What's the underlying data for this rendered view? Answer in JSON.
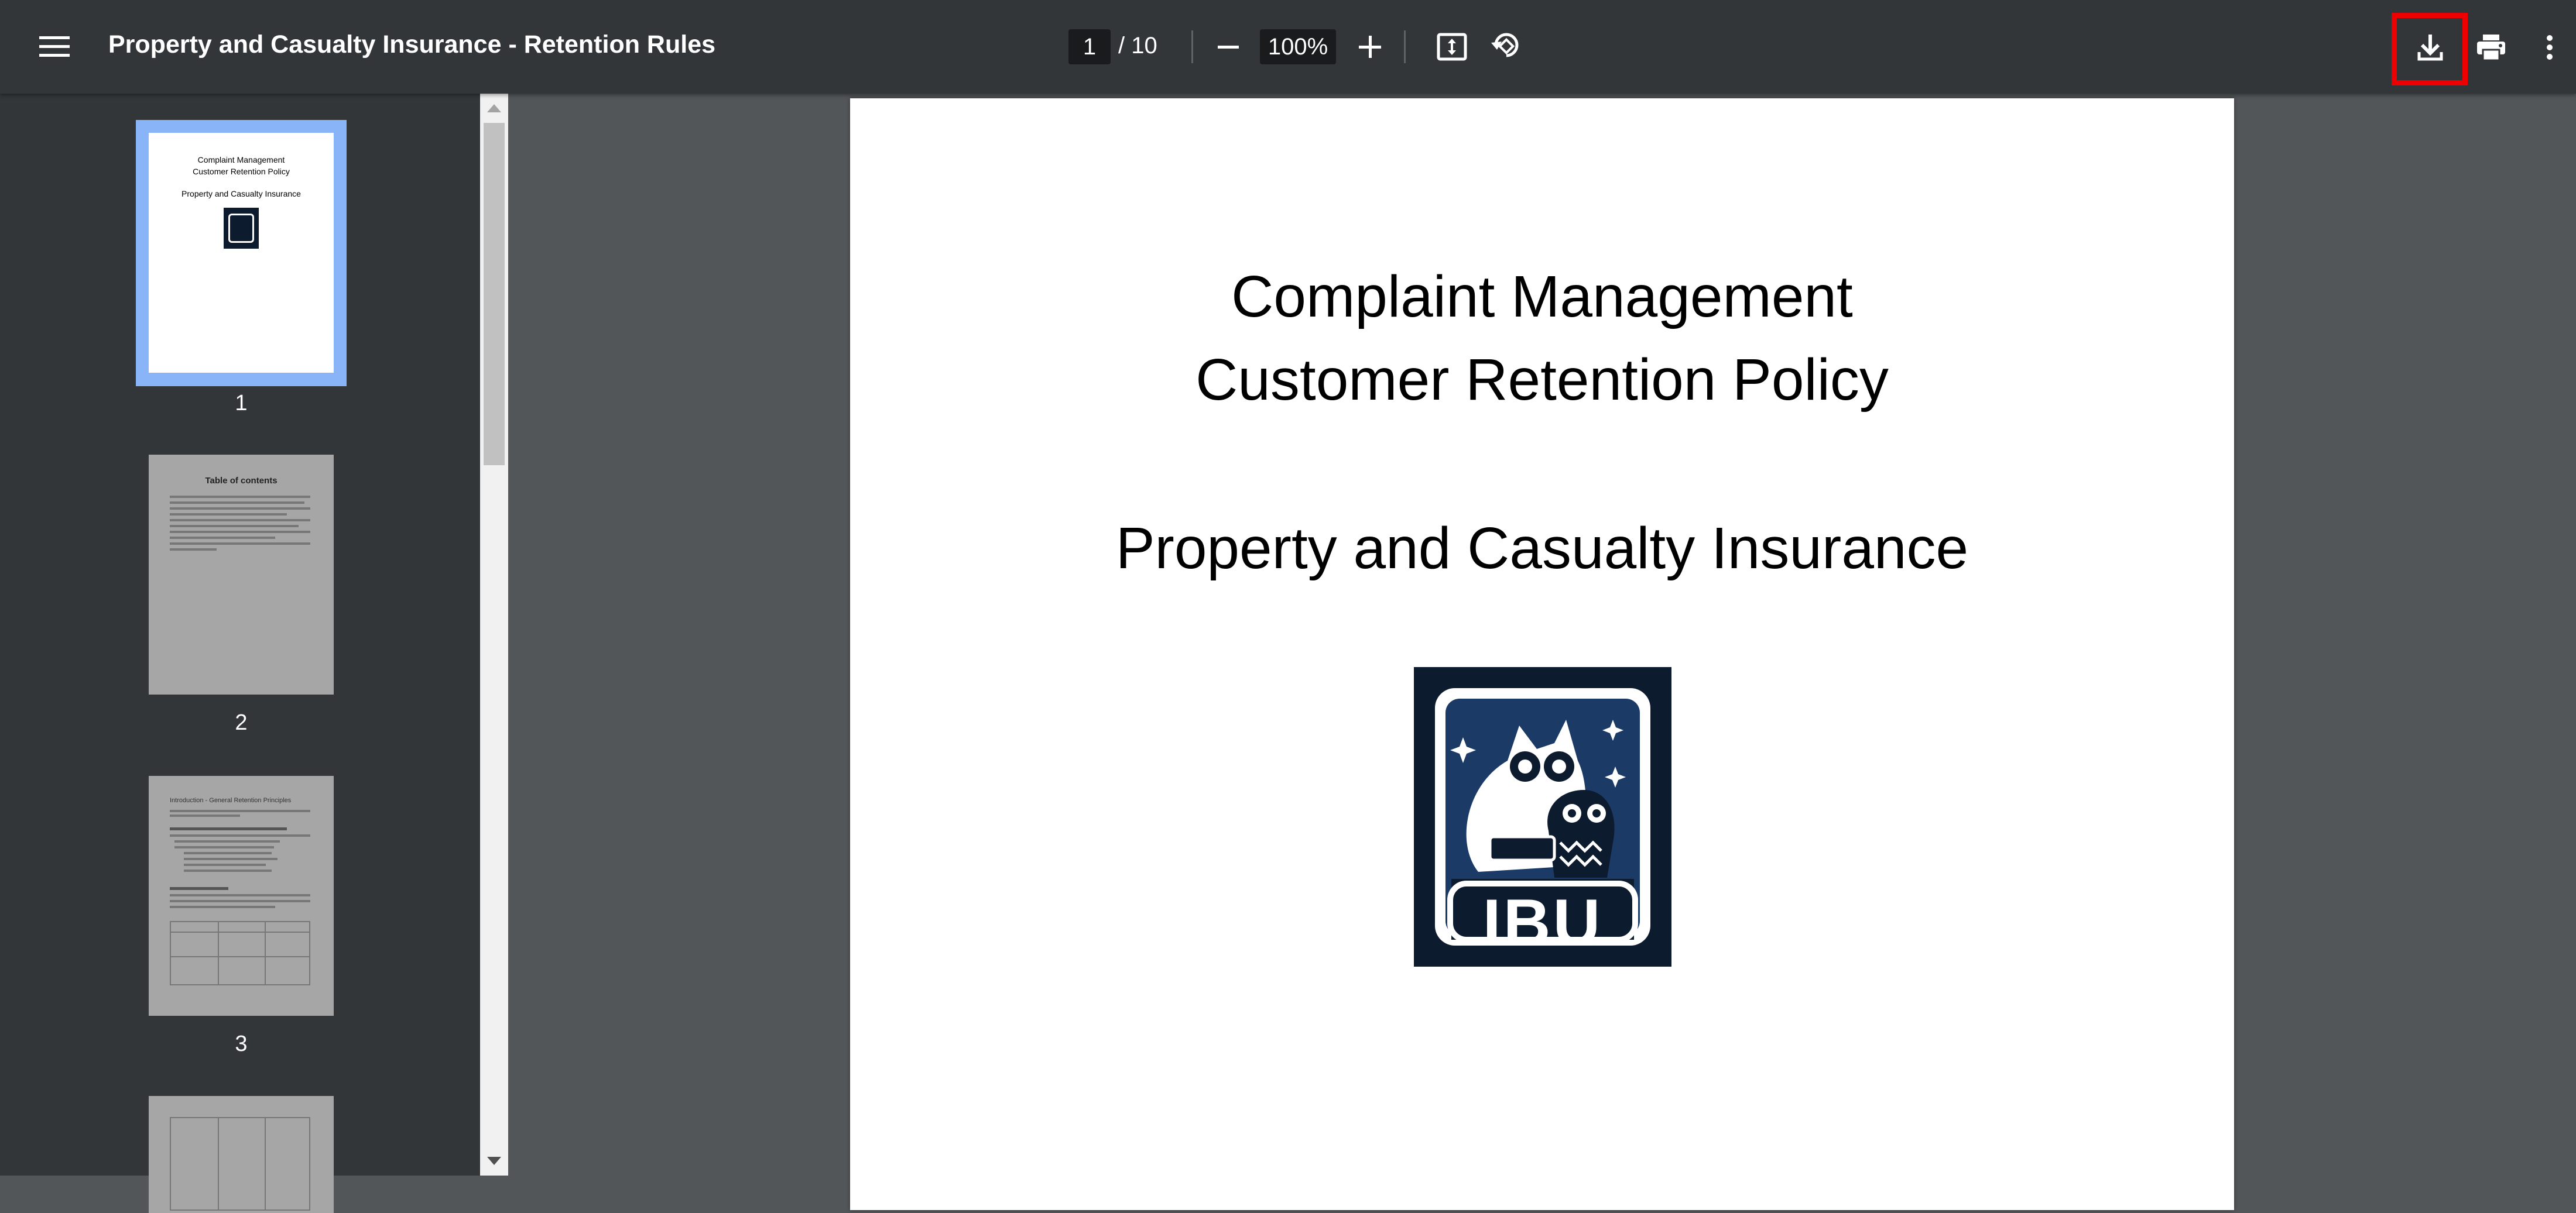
{
  "toolbar": {
    "menu_icon": "hamburger-menu-icon",
    "title": "Property and Casualty Insurance - Retention Rules",
    "current_page": "1",
    "page_total": "/ 10",
    "zoom": "100%",
    "zoom_out_icon": "minus-icon",
    "zoom_in_icon": "plus-icon",
    "fit_icon": "fit-to-page-icon",
    "rotate_icon": "rotate-icon",
    "download_icon": "download-icon",
    "print_icon": "print-icon",
    "more_icon": "more-vertical-icon"
  },
  "sidebar": {
    "thumbnails": [
      {
        "label": "1",
        "lines": [
          "Complaint Management",
          "Customer Retention Policy",
          "Property and Casualty Insurance"
        ]
      },
      {
        "label": "2",
        "heading": "Table of contents"
      },
      {
        "label": "3",
        "heading": "Introduction - General Retention Principles"
      },
      {
        "label": ""
      }
    ]
  },
  "document": {
    "line1": "Complaint Management",
    "line2": "Customer Retention Policy",
    "line3": "Property and Casualty Insurance",
    "logo_text": "IBU"
  },
  "colors": {
    "toolbar_bg": "#323639",
    "viewer_bg": "#525659",
    "logo_bg": "#0d1b2e",
    "highlight": "#ee0000"
  }
}
